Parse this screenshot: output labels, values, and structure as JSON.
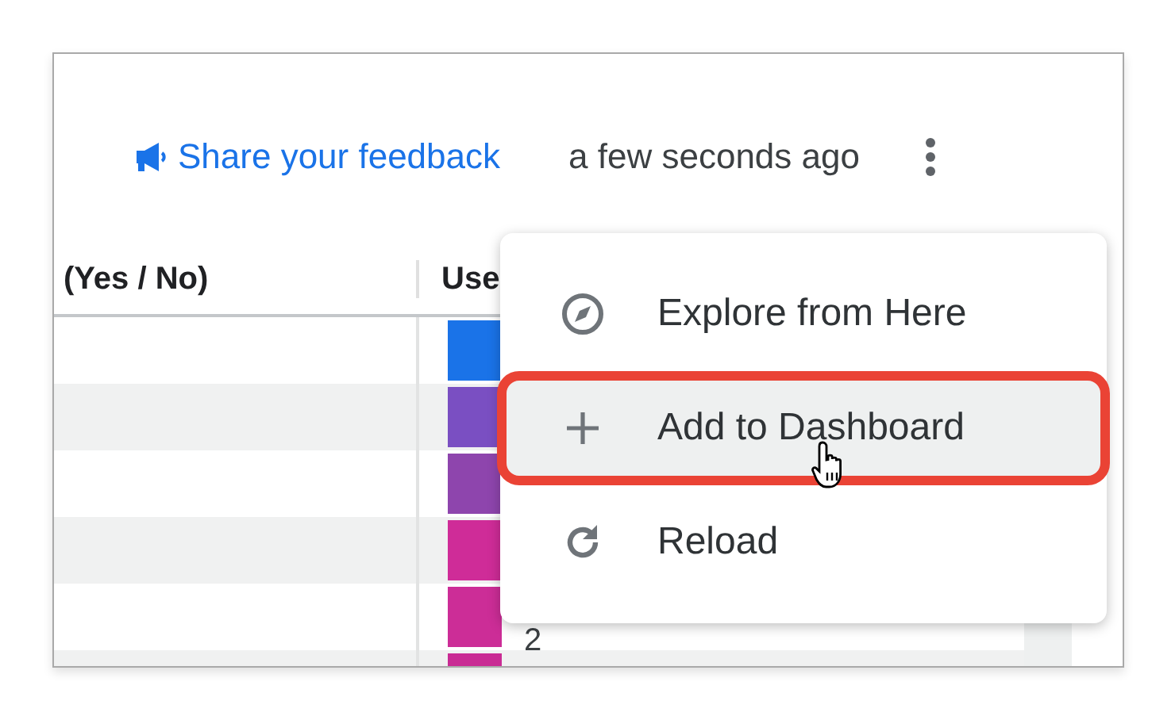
{
  "header": {
    "feedback_link": "Share your feedback",
    "updated": "a few seconds ago"
  },
  "table": {
    "columns": [
      "(Yes / No)",
      "Use"
    ],
    "rows": [
      {
        "color": "#1a73e8"
      },
      {
        "color": "#7a4fc2"
      },
      {
        "color": "#8e45ad"
      },
      {
        "color": "#cf2c98"
      },
      {
        "color": "#cc2d97",
        "value": "2"
      },
      {
        "color": "#c92b94"
      }
    ]
  },
  "menu": {
    "items": [
      {
        "kind": "compass",
        "label": "Explore from Here",
        "selected": false,
        "callout": false
      },
      {
        "kind": "plus",
        "label": "Add to Dashboard",
        "selected": true,
        "callout": true
      },
      {
        "kind": "reload",
        "label": "Reload",
        "selected": false,
        "callout": false
      }
    ]
  }
}
